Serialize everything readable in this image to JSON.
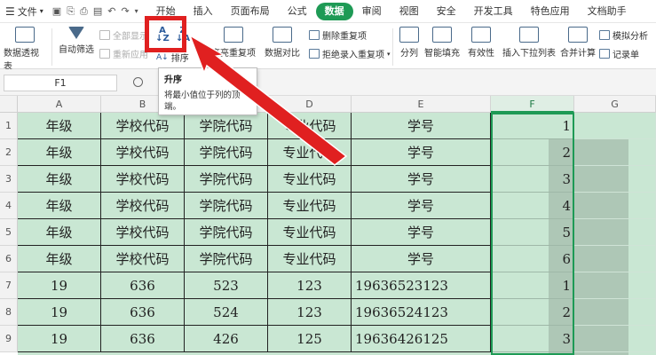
{
  "menubar": {
    "file_label": "文件",
    "tabs": [
      {
        "label": "开始",
        "active": false
      },
      {
        "label": "插入",
        "active": false
      },
      {
        "label": "页面布局",
        "active": false
      },
      {
        "label": "公式",
        "active": false
      },
      {
        "label": "数据",
        "active": true
      },
      {
        "label": "审阅",
        "active": false
      },
      {
        "label": "视图",
        "active": false
      },
      {
        "label": "安全",
        "active": false
      },
      {
        "label": "开发工具",
        "active": false
      },
      {
        "label": "特色应用",
        "active": false
      },
      {
        "label": "文档助手",
        "active": false
      }
    ]
  },
  "ribbon": {
    "pivot_table": "数据透视表",
    "auto_filter": "自动筛选",
    "show_all": "全部显示",
    "reapply": "重新应用",
    "sort": "排序",
    "highlight_duplicates": "高亮重复项",
    "data_compare": "数据对比",
    "delete_duplicates": "删除重复项",
    "reject_duplicates": "拒绝录入重复项",
    "split": "分列",
    "smart_fill": "智能填充",
    "validity": "有效性",
    "insert_dropdown": "插入下拉列表",
    "consolidate": "合并计算",
    "simulate": "模拟分析",
    "record_sheet": "记录单"
  },
  "tooltip": {
    "title": "升序",
    "body": "将最小值位于列的顶端。"
  },
  "formula_bar": {
    "name_box": "F1"
  },
  "accent_color": "#1e9a55",
  "highlight_color": "#e02020",
  "columns": [
    "A",
    "B",
    "C",
    "D",
    "E",
    "F",
    "G"
  ],
  "rows": [
    {
      "num": "1",
      "cells": [
        "年级",
        "学校代码",
        "学院代码",
        "专业代码",
        "学号",
        "1"
      ]
    },
    {
      "num": "2",
      "cells": [
        "年级",
        "学校代码",
        "学院代码",
        "专业代码",
        "学号",
        "2"
      ]
    },
    {
      "num": "3",
      "cells": [
        "年级",
        "学校代码",
        "学院代码",
        "专业代码",
        "学号",
        "3"
      ]
    },
    {
      "num": "4",
      "cells": [
        "年级",
        "学校代码",
        "学院代码",
        "专业代码",
        "学号",
        "4"
      ]
    },
    {
      "num": "5",
      "cells": [
        "年级",
        "学校代码",
        "学院代码",
        "专业代码",
        "学号",
        "5"
      ]
    },
    {
      "num": "6",
      "cells": [
        "年级",
        "学校代码",
        "学院代码",
        "专业代码",
        "学号",
        "6"
      ]
    },
    {
      "num": "7",
      "cells": [
        "19",
        "636",
        "523",
        "123",
        "19636523123",
        "1"
      ]
    },
    {
      "num": "8",
      "cells": [
        "19",
        "636",
        "524",
        "123",
        "19636524123",
        "2"
      ]
    },
    {
      "num": "9",
      "cells": [
        "19",
        "636",
        "426",
        "125",
        "19636426125",
        "3"
      ]
    }
  ]
}
